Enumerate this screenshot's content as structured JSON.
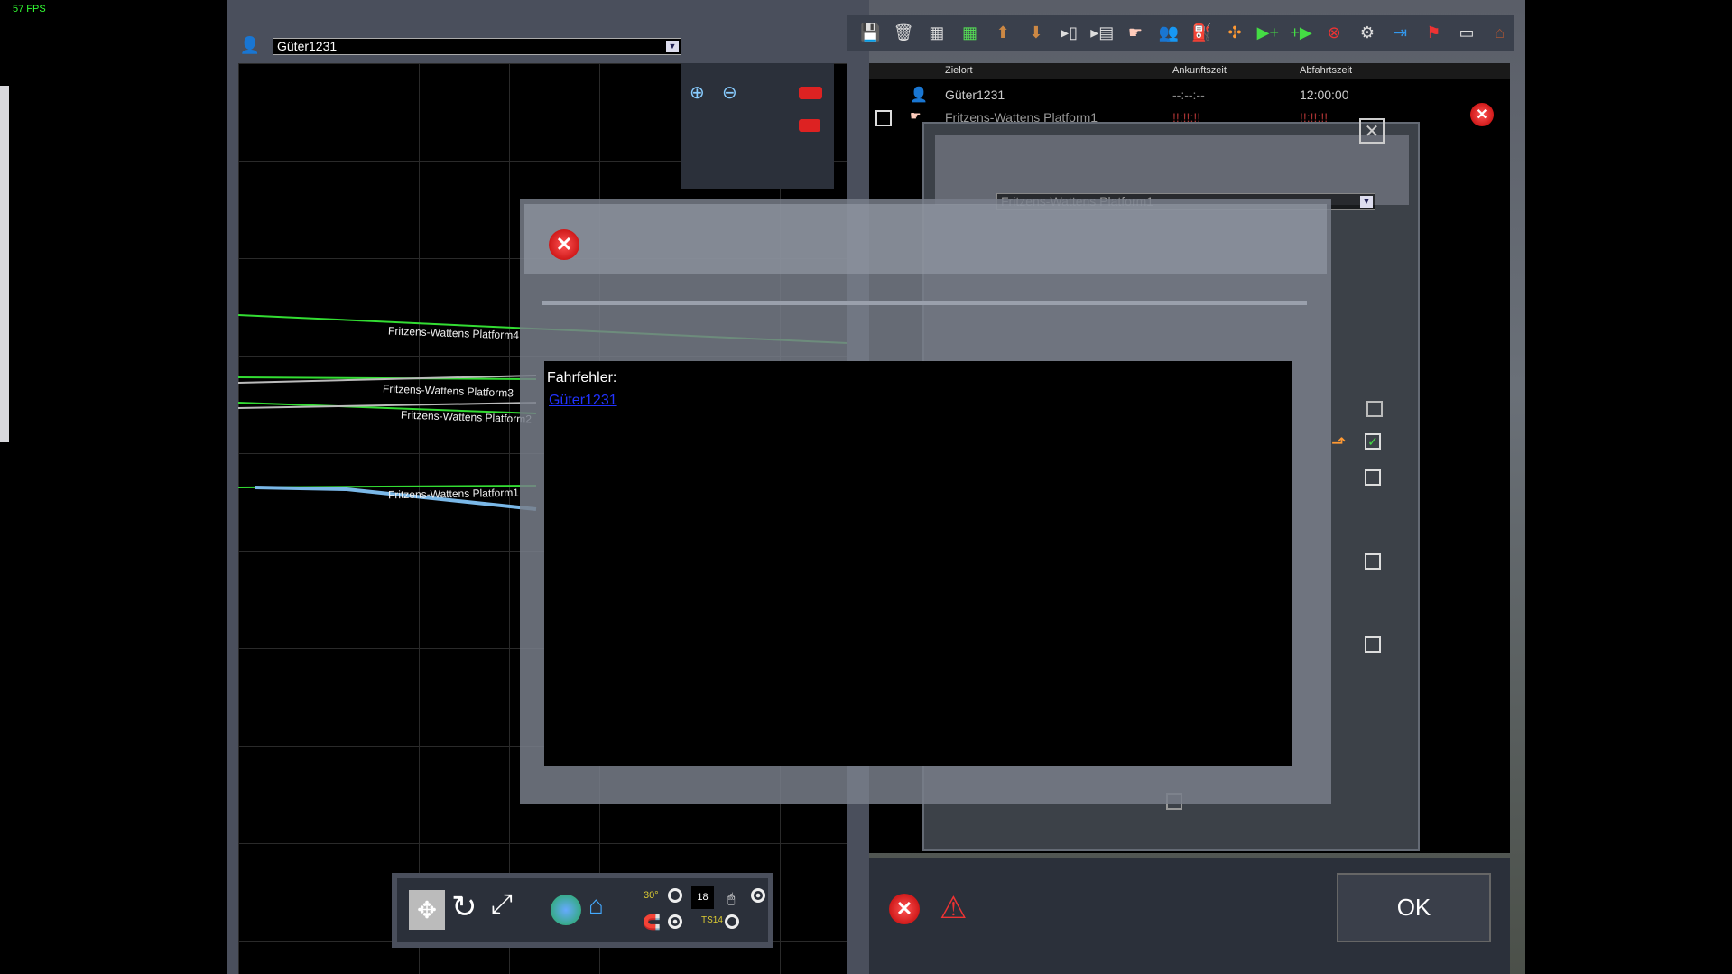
{
  "fps": "57 FPS",
  "train_selector": {
    "value": "Güter1231"
  },
  "map": {
    "platforms": [
      "Fritzens-Wattens Platform4",
      "Fritzens-Wattens Platform3",
      "Fritzens-Wattens Platform2",
      "Fritzens-Wattens Platform1"
    ]
  },
  "toolbar": {
    "icons": [
      "save-icon",
      "trash-icon",
      "grid-icon",
      "grid-green-icon",
      "move-up-icon",
      "move-down-icon",
      "insert-before-icon",
      "insert-after-icon",
      "pointer-hand-icon",
      "passengers-icon",
      "refuel-icon",
      "couple-icon",
      "add-instruction-icon",
      "add-after-icon",
      "delete-instruction-icon",
      "settings-icon",
      "enter-icon",
      "flag-icon",
      "display-icon",
      "station-icon"
    ]
  },
  "timetable": {
    "headers": [
      "Zielort",
      "Ankunftszeit",
      "Abfahrtszeit"
    ],
    "rows": [
      {
        "zielort": "Güter1231",
        "ankunft": "--:--:--",
        "abfahrt": "12:00:00"
      },
      {
        "zielort": "Fritzens-Wattens Platform1",
        "ankunft": "!!:!!:!!",
        "abfahrt": "!!:!!:!!"
      }
    ]
  },
  "ghost": {
    "dropdown": "Fritzens-Wattens Platform1"
  },
  "dialog": {
    "heading": "Fahrfehler:",
    "link": "Güter1231"
  },
  "bottom": {
    "ok": "OK",
    "counter": "18",
    "angle_label": "30°",
    "ts_label": "TS14"
  },
  "colors": {
    "track": "#33dd33",
    "route": "#7ab8e8",
    "link": "#2233ff"
  }
}
